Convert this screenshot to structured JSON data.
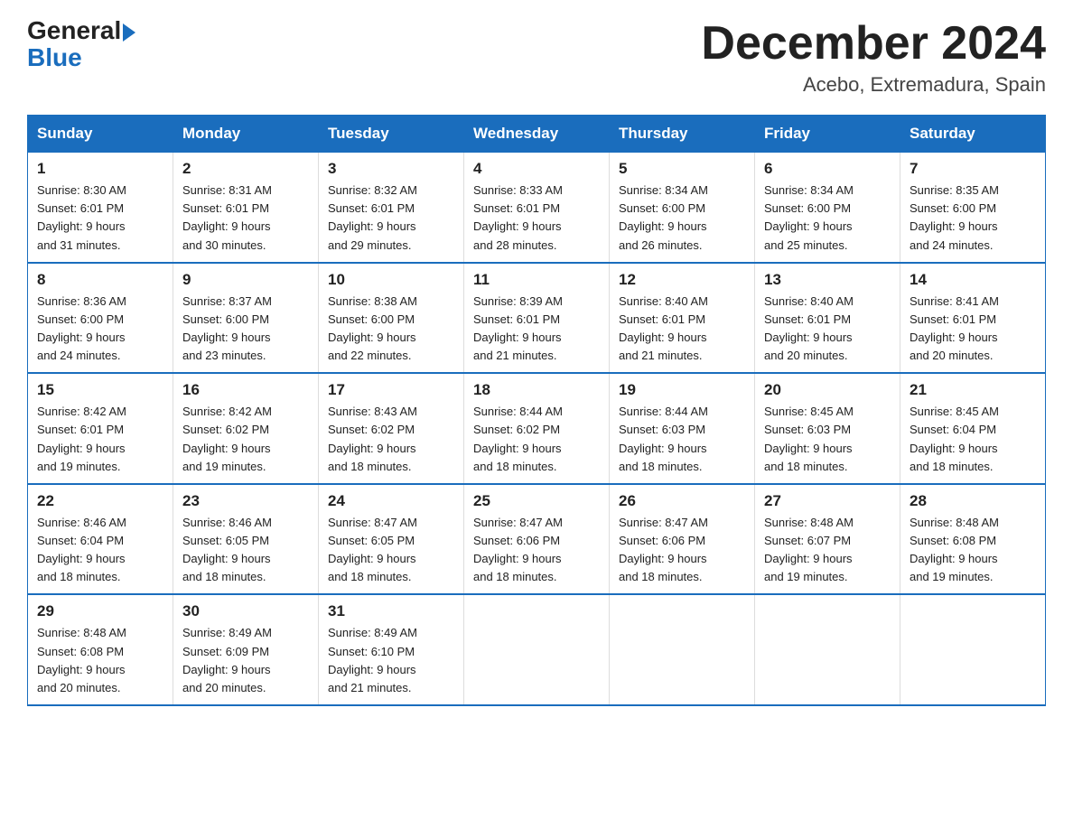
{
  "header": {
    "logo_general": "General",
    "logo_blue": "Blue",
    "month_year": "December 2024",
    "location": "Acebo, Extremadura, Spain"
  },
  "columns": [
    "Sunday",
    "Monday",
    "Tuesday",
    "Wednesday",
    "Thursday",
    "Friday",
    "Saturday"
  ],
  "weeks": [
    [
      {
        "day": "1",
        "sunrise": "8:30 AM",
        "sunset": "6:01 PM",
        "daylight": "9 hours and 31 minutes."
      },
      {
        "day": "2",
        "sunrise": "8:31 AM",
        "sunset": "6:01 PM",
        "daylight": "9 hours and 30 minutes."
      },
      {
        "day": "3",
        "sunrise": "8:32 AM",
        "sunset": "6:01 PM",
        "daylight": "9 hours and 29 minutes."
      },
      {
        "day": "4",
        "sunrise": "8:33 AM",
        "sunset": "6:01 PM",
        "daylight": "9 hours and 28 minutes."
      },
      {
        "day": "5",
        "sunrise": "8:34 AM",
        "sunset": "6:00 PM",
        "daylight": "9 hours and 26 minutes."
      },
      {
        "day": "6",
        "sunrise": "8:34 AM",
        "sunset": "6:00 PM",
        "daylight": "9 hours and 25 minutes."
      },
      {
        "day": "7",
        "sunrise": "8:35 AM",
        "sunset": "6:00 PM",
        "daylight": "9 hours and 24 minutes."
      }
    ],
    [
      {
        "day": "8",
        "sunrise": "8:36 AM",
        "sunset": "6:00 PM",
        "daylight": "9 hours and 24 minutes."
      },
      {
        "day": "9",
        "sunrise": "8:37 AM",
        "sunset": "6:00 PM",
        "daylight": "9 hours and 23 minutes."
      },
      {
        "day": "10",
        "sunrise": "8:38 AM",
        "sunset": "6:00 PM",
        "daylight": "9 hours and 22 minutes."
      },
      {
        "day": "11",
        "sunrise": "8:39 AM",
        "sunset": "6:01 PM",
        "daylight": "9 hours and 21 minutes."
      },
      {
        "day": "12",
        "sunrise": "8:40 AM",
        "sunset": "6:01 PM",
        "daylight": "9 hours and 21 minutes."
      },
      {
        "day": "13",
        "sunrise": "8:40 AM",
        "sunset": "6:01 PM",
        "daylight": "9 hours and 20 minutes."
      },
      {
        "day": "14",
        "sunrise": "8:41 AM",
        "sunset": "6:01 PM",
        "daylight": "9 hours and 20 minutes."
      }
    ],
    [
      {
        "day": "15",
        "sunrise": "8:42 AM",
        "sunset": "6:01 PM",
        "daylight": "9 hours and 19 minutes."
      },
      {
        "day": "16",
        "sunrise": "8:42 AM",
        "sunset": "6:02 PM",
        "daylight": "9 hours and 19 minutes."
      },
      {
        "day": "17",
        "sunrise": "8:43 AM",
        "sunset": "6:02 PM",
        "daylight": "9 hours and 18 minutes."
      },
      {
        "day": "18",
        "sunrise": "8:44 AM",
        "sunset": "6:02 PM",
        "daylight": "9 hours and 18 minutes."
      },
      {
        "day": "19",
        "sunrise": "8:44 AM",
        "sunset": "6:03 PM",
        "daylight": "9 hours and 18 minutes."
      },
      {
        "day": "20",
        "sunrise": "8:45 AM",
        "sunset": "6:03 PM",
        "daylight": "9 hours and 18 minutes."
      },
      {
        "day": "21",
        "sunrise": "8:45 AM",
        "sunset": "6:04 PM",
        "daylight": "9 hours and 18 minutes."
      }
    ],
    [
      {
        "day": "22",
        "sunrise": "8:46 AM",
        "sunset": "6:04 PM",
        "daylight": "9 hours and 18 minutes."
      },
      {
        "day": "23",
        "sunrise": "8:46 AM",
        "sunset": "6:05 PM",
        "daylight": "9 hours and 18 minutes."
      },
      {
        "day": "24",
        "sunrise": "8:47 AM",
        "sunset": "6:05 PM",
        "daylight": "9 hours and 18 minutes."
      },
      {
        "day": "25",
        "sunrise": "8:47 AM",
        "sunset": "6:06 PM",
        "daylight": "9 hours and 18 minutes."
      },
      {
        "day": "26",
        "sunrise": "8:47 AM",
        "sunset": "6:06 PM",
        "daylight": "9 hours and 18 minutes."
      },
      {
        "day": "27",
        "sunrise": "8:48 AM",
        "sunset": "6:07 PM",
        "daylight": "9 hours and 19 minutes."
      },
      {
        "day": "28",
        "sunrise": "8:48 AM",
        "sunset": "6:08 PM",
        "daylight": "9 hours and 19 minutes."
      }
    ],
    [
      {
        "day": "29",
        "sunrise": "8:48 AM",
        "sunset": "6:08 PM",
        "daylight": "9 hours and 20 minutes."
      },
      {
        "day": "30",
        "sunrise": "8:49 AM",
        "sunset": "6:09 PM",
        "daylight": "9 hours and 20 minutes."
      },
      {
        "day": "31",
        "sunrise": "8:49 AM",
        "sunset": "6:10 PM",
        "daylight": "9 hours and 21 minutes."
      },
      null,
      null,
      null,
      null
    ]
  ],
  "labels": {
    "sunrise": "Sunrise:",
    "sunset": "Sunset:",
    "daylight": "Daylight:"
  }
}
